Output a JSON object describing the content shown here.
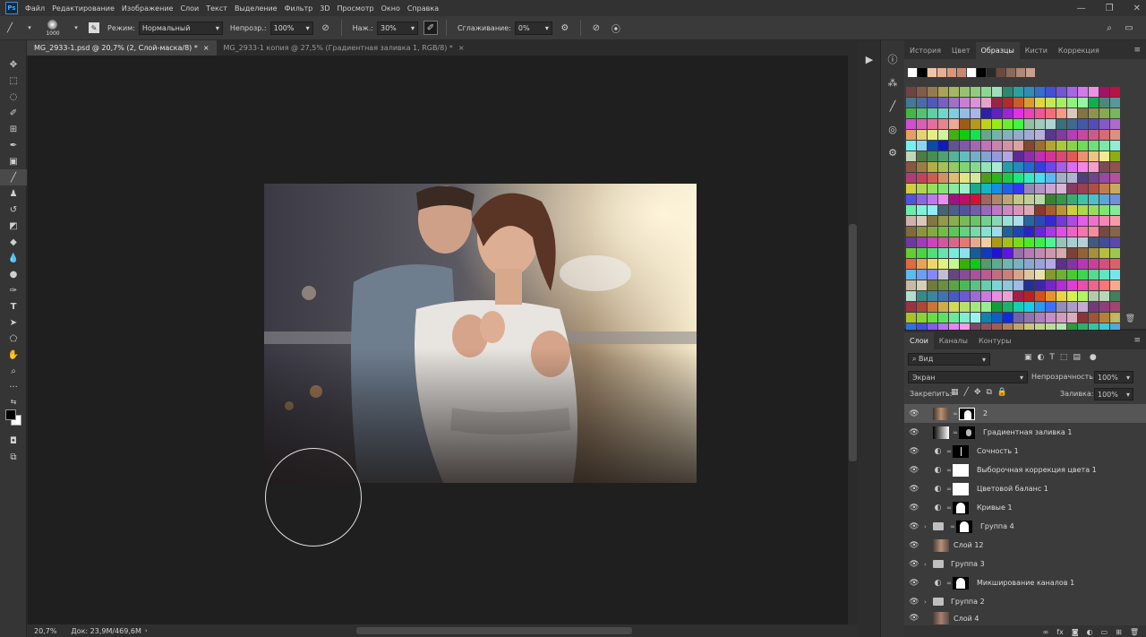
{
  "app": {
    "logo": "Ps"
  },
  "menu": [
    "Файл",
    "Редактирование",
    "Изображение",
    "Слои",
    "Текст",
    "Выделение",
    "Фильтр",
    "3D",
    "Просмотр",
    "Окно",
    "Справка"
  ],
  "options": {
    "brush_size": "1000",
    "mode_label": "Режим:",
    "mode_value": "Нормальный",
    "opacity_label": "Непрозр.:",
    "opacity_value": "100%",
    "pressure_label": "Наж.:",
    "pressure_value": "30%",
    "smoothing_label": "Сглаживание:",
    "smoothing_value": "0%"
  },
  "tabs": [
    {
      "label": "MG_2933-1.psd @ 20,7% (2, Слой-маска/8) *",
      "close": "×"
    },
    {
      "label": "MG_2933-1 копия @ 27,5% (Градиентная заливка 1, RGB/8) *",
      "close": "×"
    }
  ],
  "status": {
    "zoom": "20,7%",
    "doc": "Док: 23,9M/469,6M"
  },
  "swatch_panel": {
    "tabs": [
      "История",
      "Цвет",
      "Образцы",
      "Кисти",
      "Коррекция"
    ],
    "active_tab": "Образцы",
    "recent_colors": [
      "#ffffff",
      "#000000",
      "#f2c3a8",
      "#e8b090",
      "#d89878",
      "#c88870",
      "#ffffff",
      "#000000",
      "#2a2a2a",
      "#6a4a3a",
      "#8a6a5a",
      "#b08878",
      "#c8a090"
    ]
  },
  "layers_panel": {
    "tabs": [
      "Слои",
      "Каналы",
      "Контуры"
    ],
    "active_tab": "Слои",
    "filter_value": "Вид",
    "blend_mode": "Экран",
    "opacity_label": "Непрозрачность:",
    "opacity_value": "100%",
    "lock_label": "Закрепить:",
    "fill_label": "Заливка:",
    "fill_value": "100%",
    "layers": [
      {
        "name": "2",
        "type": "pixel-mask",
        "selected": true
      },
      {
        "name": "Градиентная заливка 1",
        "type": "gradient"
      },
      {
        "name": "Сочность 1",
        "type": "adjustment"
      },
      {
        "name": "Выборочная коррекция цвета 1",
        "type": "adjustment"
      },
      {
        "name": "Цветовой баланс 1",
        "type": "adjustment"
      },
      {
        "name": "Кривые 1",
        "type": "adjustment"
      },
      {
        "name": "Группа 4",
        "type": "group-mask"
      },
      {
        "name": "Слой 12",
        "type": "pixel"
      },
      {
        "name": "Группа 3",
        "type": "group"
      },
      {
        "name": "Микширование каналов 1",
        "type": "adjustment"
      },
      {
        "name": "Группа 2",
        "type": "group"
      },
      {
        "name": "Слой 4",
        "type": "pixel"
      }
    ]
  },
  "icons": {
    "home": "home-icon",
    "brush": "brush-icon",
    "airbrush": "airbrush-icon",
    "settings": "gear-icon",
    "search": "search-icon",
    "workspace": "workspace-icon",
    "play": "play-icon"
  },
  "colors": {
    "accent": "#4aa6ff",
    "panel": "#3b3b3b",
    "canvas": "#1f1f1f"
  }
}
